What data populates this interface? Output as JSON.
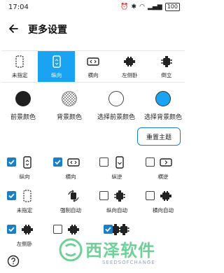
{
  "status_bar": {
    "time": "17:04",
    "battery": "100"
  },
  "header": {
    "title": "更多设置"
  },
  "orientation_tabs": [
    {
      "label": "未指定",
      "selected": false,
      "icon": "dashed-phone-icon"
    },
    {
      "label": "纵向",
      "selected": true,
      "icon": "portrait-phone-icon"
    },
    {
      "label": "横向",
      "selected": false,
      "icon": "landscape-phone-icon"
    },
    {
      "label": "左侧卧",
      "selected": false,
      "icon": "robot-left-icon"
    },
    {
      "label": "倒立",
      "selected": false,
      "icon": "robot-upside-down-icon"
    }
  ],
  "colors": [
    {
      "label": "前景颜色",
      "color": "#1f1f1f"
    },
    {
      "label": "背景颜色",
      "color": "checkered"
    },
    {
      "label": "选择前景颜色",
      "color": "#ffffff"
    },
    {
      "label": "选择背景颜色",
      "color": "#1aa3f2"
    }
  ],
  "reset_button": "重置主题",
  "options": [
    {
      "label": "纵向",
      "checked": true,
      "icon": "portrait-phone-icon"
    },
    {
      "label": "横向",
      "checked": true,
      "icon": "landscape-phone-icon"
    },
    {
      "label": "纵逆",
      "checked": false,
      "icon": "portrait-reverse-icon"
    },
    {
      "label": "横逆",
      "checked": false,
      "icon": "landscape-reverse-icon"
    },
    {
      "label": "未指定",
      "checked": true,
      "icon": "dashed-phone-icon"
    },
    {
      "label": "强制自动",
      "checked": false,
      "icon": "rotate-arrows-icon"
    },
    {
      "label": "纵向自动",
      "checked": false,
      "icon": "robot-portrait-icon"
    },
    {
      "label": "横向自动",
      "checked": false,
      "icon": "robot-landscape-icon"
    },
    {
      "label": "左侧卧",
      "checked": true,
      "icon": "robot-left-icon"
    },
    {
      "label": "",
      "checked": false,
      "icon": "robot-right-icon"
    },
    {
      "label": "",
      "checked": false,
      "icon": "robot-down-icon"
    },
    {
      "label": "",
      "checked": true,
      "icon": "robot-up-icon"
    }
  ],
  "watermark": {
    "text": "西泽软件",
    "subtext": "SEEDSOFCHANGE"
  }
}
